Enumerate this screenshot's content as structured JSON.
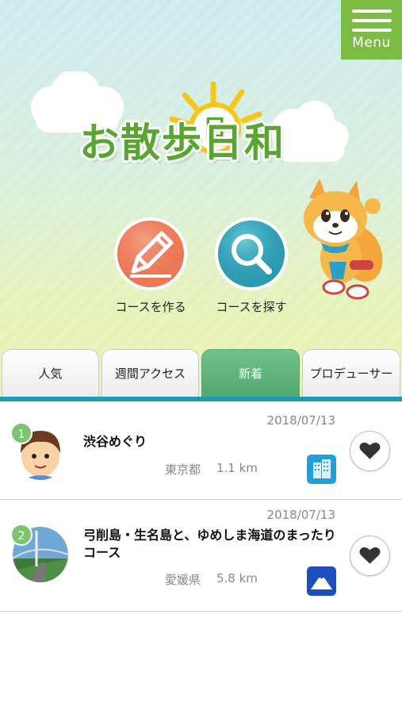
{
  "header": {
    "menu_label": "Menu"
  },
  "logo": {
    "text": "お散歩日和"
  },
  "actions": [
    {
      "label": "コースを作る",
      "icon": "pencil-icon"
    },
    {
      "label": "コースを探す",
      "icon": "magnifier-icon"
    }
  ],
  "tabs": [
    {
      "label": "人気",
      "active": false
    },
    {
      "label": "週間アクセス",
      "active": false
    },
    {
      "label": "新着",
      "active": true
    },
    {
      "label": "プロデューサー",
      "active": false
    }
  ],
  "courses": [
    {
      "rank": "1",
      "date": "2018/07/13",
      "title": "渋谷めぐり",
      "prefecture": "東京都",
      "distance": "1.1 km",
      "category_icon": "building-icon",
      "category_color": "#1fa0dc"
    },
    {
      "rank": "2",
      "date": "2018/07/13",
      "title": "弓削島・生名島と、ゆめしま海道のまったりコース",
      "prefecture": "愛媛県",
      "distance": "5.8 km",
      "category_icon": "mountain-icon",
      "category_color": "#1d4fbf"
    }
  ],
  "colors": {
    "accent_green": "#7cbc45",
    "tab_active": "#4fa870",
    "tab_line": "#1d9bb4"
  }
}
